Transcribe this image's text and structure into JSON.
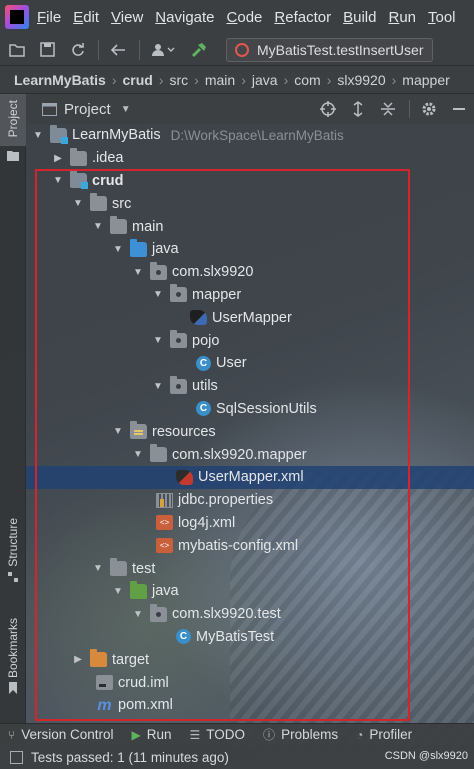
{
  "menubar": {
    "items": [
      {
        "label": "File",
        "mnemonic": "F",
        "rest": "ile"
      },
      {
        "label": "Edit",
        "mnemonic": "E",
        "rest": "dit"
      },
      {
        "label": "View",
        "mnemonic": "V",
        "rest": "iew"
      },
      {
        "label": "Navigate",
        "mnemonic": "N",
        "rest": "avigate"
      },
      {
        "label": "Code",
        "mnemonic": "C",
        "rest": "ode"
      },
      {
        "label": "Refactor",
        "mnemonic": "R",
        "rest": "efactor"
      },
      {
        "label": "Build",
        "mnemonic": "B",
        "rest": "uild"
      },
      {
        "label": "Run",
        "mnemonic": "R",
        "rest": "un"
      },
      {
        "label": "Tools",
        "mnemonic": "T",
        "rest": "ool"
      }
    ]
  },
  "toolbar": {
    "run_config": "MyBatisTest.testInsertUser"
  },
  "breadcrumb": [
    "LearnMyBatis",
    "crud",
    "src",
    "main",
    "java",
    "com",
    "slx9920",
    "mapper"
  ],
  "sidebar_tabs": {
    "project": "Project",
    "structure": "Structure",
    "bookmarks": "Bookmarks"
  },
  "panel": {
    "title": "Project"
  },
  "tree": {
    "root_label": "LearnMyBatis",
    "root_path": "D:\\WorkSpace\\LearnMyBatis",
    "idea": ".idea",
    "crud": "crud",
    "src": "src",
    "main": "main",
    "java": "java",
    "pkg_root": "com.slx9920",
    "mapper": "mapper",
    "user_mapper": "UserMapper",
    "pojo": "pojo",
    "user": "User",
    "utils": "utils",
    "sql_session_utils": "SqlSessionUtils",
    "resources": "resources",
    "res_mapper_pkg": "com.slx9920.mapper",
    "user_mapper_xml": "UserMapper.xml",
    "jdbc_properties": "jdbc.properties",
    "log4j_xml": "log4j.xml",
    "mybatis_config": "mybatis-config.xml",
    "test": "test",
    "test_java": "java",
    "test_pkg": "com.slx9920.test",
    "mybatis_test": "MyBatisTest",
    "target": "target",
    "crud_iml": "crud.iml",
    "pom_xml": "pom.xml"
  },
  "bottom_tabs": [
    "Version Control",
    "Run",
    "TODO",
    "Problems",
    "Profiler"
  ],
  "statusbar": {
    "message": "Tests passed: 1 (11 minutes ago)",
    "watermark": "CSDN @slx9920"
  },
  "colors": {
    "selection": "#214273",
    "highlight_box": "#d4242c",
    "source_folder": "#3d8fd6",
    "test_folder": "#62a046",
    "excluded_folder": "#d88a3c"
  }
}
